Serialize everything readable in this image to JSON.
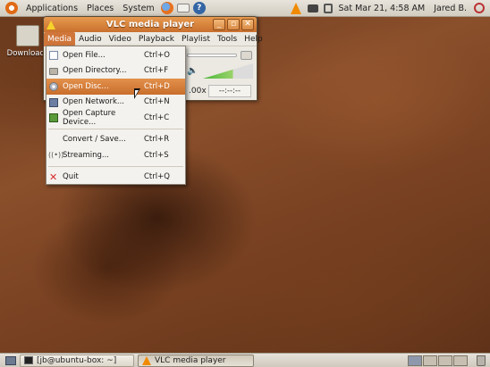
{
  "top_panel": {
    "menus": [
      "Applications",
      "Places",
      "System"
    ],
    "launchers": [
      "firefox-icon",
      "mail-icon",
      "help-icon"
    ],
    "tray_icons": [
      "vlc-icon",
      "battery-icon",
      "network-icon"
    ],
    "clock": "Sat Mar 21,  4:58 AM",
    "user": "Jared B."
  },
  "desktop": {
    "icon_label": "Downloads"
  },
  "vlc": {
    "title": "VLC media player",
    "menubar": [
      "Media",
      "Audio",
      "Video",
      "Playback",
      "Playlist",
      "Tools",
      "Help"
    ],
    "active_menu": "Media",
    "speed": ".00x",
    "time": "--:--:--"
  },
  "media_menu": {
    "items": [
      {
        "label": "Open File...",
        "shortcut": "Ctrl+O",
        "icon": "file-icon"
      },
      {
        "label": "Open Directory...",
        "shortcut": "Ctrl+F",
        "icon": "folder-icon"
      },
      {
        "label": "Open Disc...",
        "shortcut": "Ctrl+D",
        "icon": "disc-icon",
        "highlighted": true
      },
      {
        "label": "Open Network...",
        "shortcut": "Ctrl+N",
        "icon": "network-icon"
      },
      {
        "label": "Open Capture Device...",
        "shortcut": "Ctrl+C",
        "icon": "capture-icon"
      },
      {
        "label": "Convert / Save...",
        "shortcut": "Ctrl+R",
        "icon": ""
      },
      {
        "label": "Streaming...",
        "shortcut": "Ctrl+S",
        "icon": "stream-icon"
      },
      {
        "label": "Quit",
        "shortcut": "Ctrl+Q",
        "icon": "quit-icon"
      }
    ]
  },
  "bottom_panel": {
    "tasks": [
      {
        "label": "[jb@ubuntu-box: ~]",
        "icon": "terminal-icon"
      },
      {
        "label": "VLC media player",
        "icon": "vlc-icon"
      }
    ],
    "workspaces": 4
  },
  "colors": {
    "accent": "#d0763a",
    "titlebar": "#e79a4f",
    "vlc_orange": "#f08a00"
  }
}
